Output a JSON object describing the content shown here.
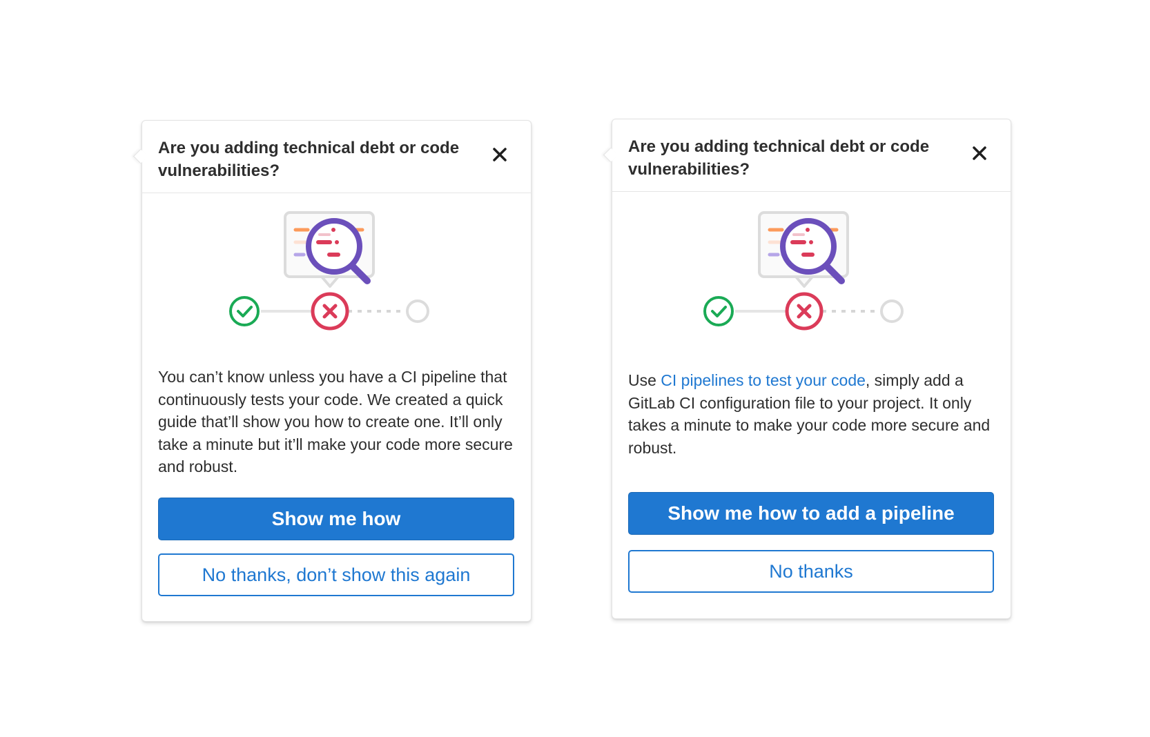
{
  "popover_a": {
    "title": "Are you adding technical debt or code vulnerabilities?",
    "body": "You can’t know unless you have a CI pipeline that continuously tests your code. We created a quick guide that’ll show you how to create one. It’ll only take a minute but it’ll make your code more secure and robust.",
    "primary_label": "Show me how",
    "secondary_label": "No thanks, don’t show this again"
  },
  "popover_b": {
    "title": "Are you adding technical debt or code vulnerabilities?",
    "body_prefix": "Use ",
    "body_link": "CI pipelines to test your code",
    "body_suffix": ", simply add a GitLab CI configuration file to your project. It only takes a minute to make your code more secure and robust.",
    "primary_label": "Show me how to add a pipeline",
    "secondary_label": "No thanks"
  },
  "icons": {
    "close": "close-icon",
    "illustration": "pipeline-magnifier-illustration",
    "passed": "check-circle-icon",
    "failed": "x-circle-icon",
    "pending": "empty-circle-icon"
  },
  "colors": {
    "primary": "#1f78d1",
    "success": "#1aaa55",
    "danger": "#db3b59",
    "purple": "#6b4fbb",
    "orange": "#fc6d26"
  }
}
